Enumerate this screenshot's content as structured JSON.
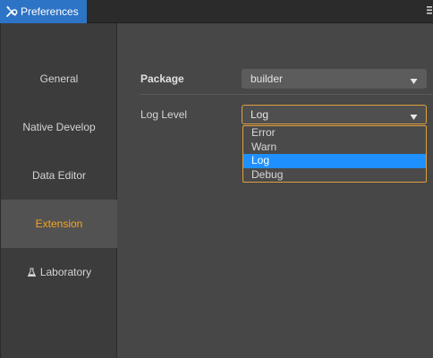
{
  "window": {
    "tab_title": "Preferences",
    "tab_icon": "tools-icon",
    "menu_icon": "hamburger-menu-icon",
    "accent": "#2d73c6"
  },
  "sidebar": {
    "items": [
      {
        "label": "General",
        "active": false
      },
      {
        "label": "Native Develop",
        "active": false
      },
      {
        "label": "Data Editor",
        "active": false
      },
      {
        "label": "Extension",
        "active": true
      },
      {
        "label": "Laboratory",
        "active": false,
        "icon": "flask-icon"
      }
    ],
    "active_color": "#f5a623"
  },
  "settings": {
    "package": {
      "label": "Package",
      "value": "builder"
    },
    "log_level": {
      "label": "Log Level",
      "value": "Log",
      "options": [
        "Error",
        "Warn",
        "Log",
        "Debug"
      ],
      "selected_index": 2
    }
  },
  "colors": {
    "selection": "#1e90ff",
    "focus_border": "#e0a040"
  }
}
